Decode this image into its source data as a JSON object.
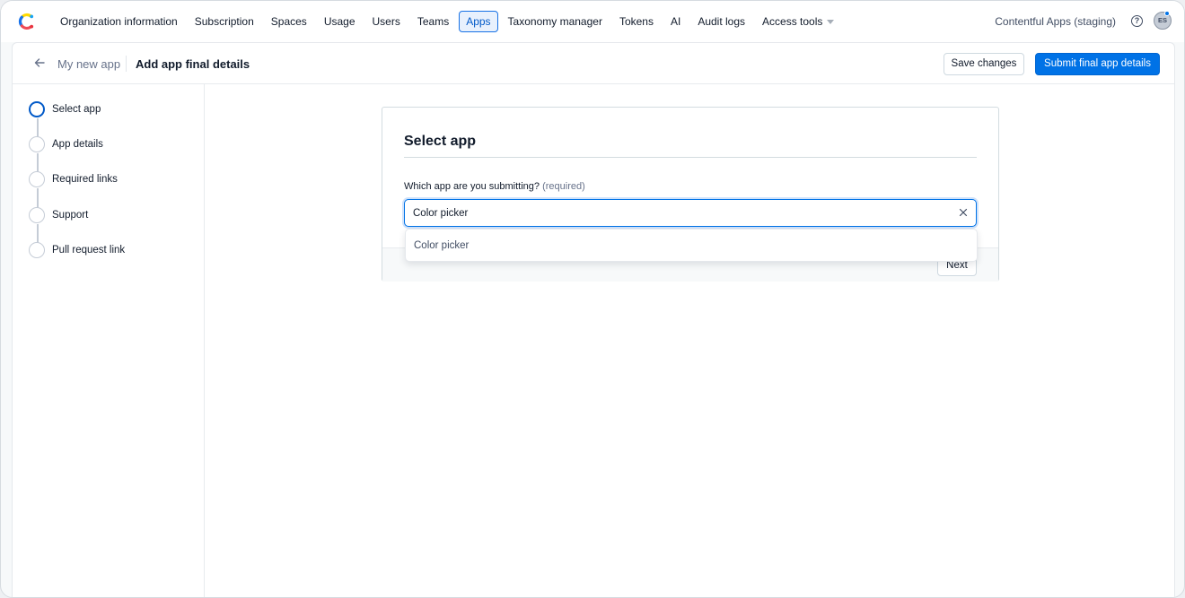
{
  "nav": {
    "items": [
      {
        "label": "Organization information"
      },
      {
        "label": "Subscription"
      },
      {
        "label": "Spaces"
      },
      {
        "label": "Usage"
      },
      {
        "label": "Users"
      },
      {
        "label": "Teams"
      },
      {
        "label": "Apps",
        "active": true
      },
      {
        "label": "Taxonomy manager"
      },
      {
        "label": "Tokens"
      },
      {
        "label": "AI"
      },
      {
        "label": "Audit logs"
      },
      {
        "label": "Access tools",
        "dropdown": true
      }
    ],
    "org_name": "Contentful Apps (staging)",
    "help_symbol": "?",
    "avatar_initials": "ES"
  },
  "header": {
    "back_icon": "arrow-left-icon",
    "breadcrumb_parent": "My new app",
    "title": "Add app final details",
    "save_label": "Save changes",
    "submit_label": "Submit final app details"
  },
  "steps": [
    {
      "label": "Select app",
      "current": true
    },
    {
      "label": "App details"
    },
    {
      "label": "Required links"
    },
    {
      "label": "Support"
    },
    {
      "label": "Pull request link"
    }
  ],
  "card": {
    "title": "Select app",
    "field_label": "Which app are you submitting?",
    "field_required": "(required)",
    "input_value": "Color picker",
    "next_label": "Next"
  },
  "autocomplete": {
    "options": [
      "Color picker"
    ]
  },
  "colors": {
    "primary": "#0072e6",
    "active_tab_bg": "#e8f1fd",
    "text": "#111b2b",
    "muted": "#67728a"
  }
}
